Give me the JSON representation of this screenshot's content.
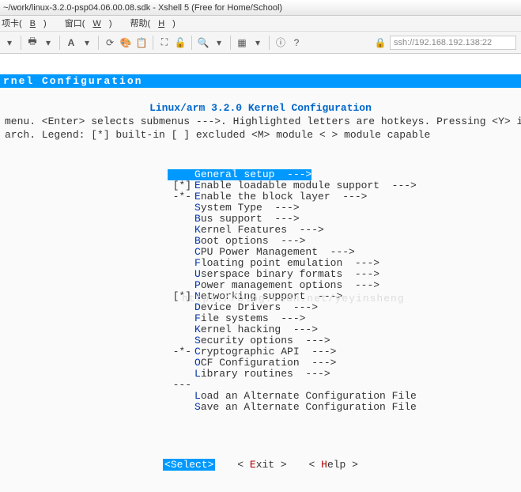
{
  "window": {
    "title": "~/work/linux-3.2.0-psp04.06.00.08.sdk - Xshell 5 (Free for Home/School)"
  },
  "menubar": {
    "items": [
      {
        "hot": "B",
        "rest": ")",
        "pre": "项卡("
      },
      {
        "hot": "W",
        "rest": ")",
        "pre": "窗口("
      },
      {
        "hot": "H",
        "rest": ")",
        "pre": "帮助("
      }
    ]
  },
  "toolbar": {
    "address": "ssh://192.168.192.138:22",
    "lock_icon": "🔒"
  },
  "kconfig": {
    "header": "rnel Configuration",
    "title": "Linux/arm 3.2.0 Kernel Configuration",
    "help1": "menu.  <Enter> selects submenus --->.  Highlighted letters are hotkeys.  Pressing <Y> includes, <N> e",
    "help2": "arch.  Legend: [*] built-in  [ ] excluded  <M> module  < > module capable",
    "items": [
      {
        "prefix": "",
        "hk": "G",
        "label": "eneral setup  --->",
        "sel": true
      },
      {
        "prefix": "[*]",
        "hk": "E",
        "label": "nable loadable module support  --->"
      },
      {
        "prefix": "-*-",
        "hk": "E",
        "label": "nable the block layer  --->"
      },
      {
        "prefix": "",
        "hk": "S",
        "label": "ystem Type  --->"
      },
      {
        "prefix": "",
        "hk": "B",
        "label": "us support  --->"
      },
      {
        "prefix": "",
        "hk": "K",
        "label": "ernel Features  --->"
      },
      {
        "prefix": "",
        "hk": "B",
        "label": "oot options  --->"
      },
      {
        "prefix": "",
        "hk": "C",
        "label": "PU Power Management  --->"
      },
      {
        "prefix": "",
        "hk": "F",
        "label": "loating point emulation  --->"
      },
      {
        "prefix": "",
        "hk": "U",
        "label": "serspace binary formats  --->"
      },
      {
        "prefix": "",
        "hk": "P",
        "label": "ower management options  --->"
      },
      {
        "prefix": "[*]",
        "hk": "N",
        "label": "etworking support  --->"
      },
      {
        "prefix": "",
        "hk": "D",
        "label": "evice Drivers  --->"
      },
      {
        "prefix": "",
        "hk": "F",
        "label": "ile systems  --->"
      },
      {
        "prefix": "",
        "hk": "K",
        "label": "ernel hacking  --->"
      },
      {
        "prefix": "",
        "hk": "S",
        "label": "ecurity options  --->"
      },
      {
        "prefix": "-*-",
        "hk": "C",
        "label": "ryptographic API  --->"
      },
      {
        "prefix": "",
        "hk": "O",
        "label": "CF Configuration  --->"
      },
      {
        "prefix": "",
        "hk": "L",
        "label": "ibrary routines  --->"
      },
      {
        "prefix": "---",
        "hk": "",
        "label": ""
      },
      {
        "prefix": "",
        "hk": "L",
        "label": "oad an Alternate Configuration File"
      },
      {
        "prefix": "",
        "hk": "S",
        "label": "ave an Alternate Configuration File"
      }
    ],
    "buttons": {
      "select": {
        "open": "<",
        "hk": "S",
        "rest": "elect>",
        "sel": true
      },
      "exit": {
        "open": "< ",
        "hk": "E",
        "rest": "xit >"
      },
      "help": {
        "open": "< ",
        "hk": "H",
        "rest": "elp >"
      }
    }
  },
  "watermark": "https://blog.csdn.net/yeyinsheng"
}
